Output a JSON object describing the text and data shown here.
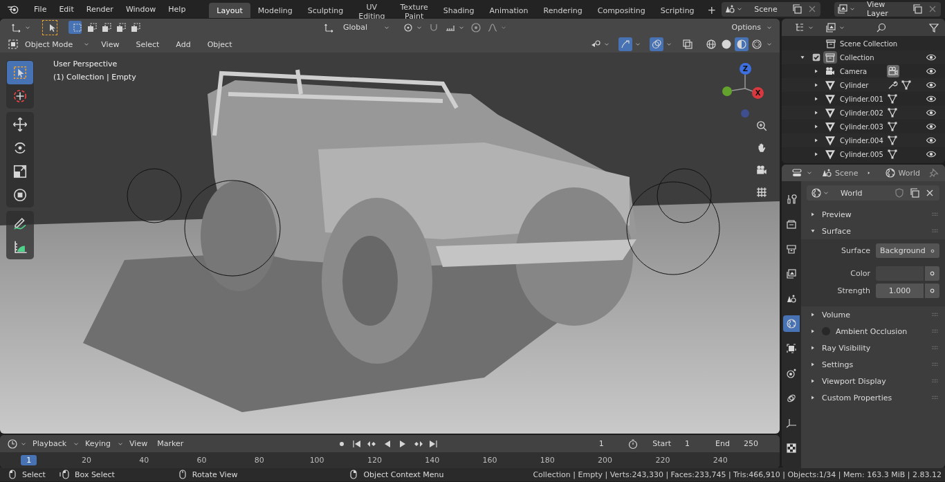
{
  "topbar": {
    "menus": [
      "File",
      "Edit",
      "Render",
      "Window",
      "Help"
    ],
    "workspaces": [
      {
        "label": "Layout",
        "selected": true
      },
      {
        "label": "Modeling",
        "selected": false
      },
      {
        "label": "Sculpting",
        "selected": false
      },
      {
        "label": "UV Editing",
        "selected": false
      },
      {
        "label": "Texture Paint",
        "selected": false
      },
      {
        "label": "Shading",
        "selected": false
      },
      {
        "label": "Animation",
        "selected": false
      },
      {
        "label": "Rendering",
        "selected": false
      },
      {
        "label": "Compositing",
        "selected": false
      },
      {
        "label": "Scripting",
        "selected": false
      }
    ],
    "add_workspace": "+",
    "scene": "Scene",
    "view_layer": "View Layer"
  },
  "viewport": {
    "tool_settings": {
      "select_modes": [
        {
          "kind": "new",
          "selected": true
        },
        {
          "kind": "extend",
          "selected": false
        },
        {
          "kind": "subtract",
          "selected": false
        },
        {
          "kind": "invert",
          "selected": false
        },
        {
          "kind": "intersect",
          "selected": false
        }
      ],
      "orientation": "Global",
      "options": "Options"
    },
    "header": {
      "mode": "Object Mode",
      "menus": [
        "View",
        "Select",
        "Add",
        "Object"
      ],
      "gizmos": true,
      "overlays": true,
      "shading": [
        {
          "kind": "wireframe",
          "selected": false
        },
        {
          "kind": "solid",
          "selected": false
        },
        {
          "kind": "material",
          "selected": true
        },
        {
          "kind": "rendered",
          "selected": false
        }
      ]
    },
    "info": [
      "User Perspective",
      "(1) Collection | Empty"
    ],
    "gizmo_labels": {
      "z": "Z",
      "x": "X"
    },
    "tool_groups": [
      [
        {
          "kind": "select",
          "selected": true
        },
        {
          "kind": "cursor",
          "selected": false
        }
      ],
      [
        {
          "kind": "move",
          "selected": false
        },
        {
          "kind": "rotate",
          "selected": false
        },
        {
          "kind": "scale",
          "selected": false
        },
        {
          "kind": "transform",
          "selected": false
        }
      ],
      [
        {
          "kind": "annotate",
          "selected": false
        },
        {
          "kind": "measure",
          "selected": false
        }
      ]
    ]
  },
  "timeline": {
    "menus": [
      "Playback",
      "Keying",
      "View",
      "Marker"
    ],
    "current_frame": "1",
    "start_label": "Start",
    "start": "1",
    "end_label": "End",
    "end": "250",
    "ruler": [
      {
        "label": "1",
        "selected": true
      },
      {
        "label": "20",
        "selected": false
      },
      {
        "label": "40",
        "selected": false
      },
      {
        "label": "60",
        "selected": false
      },
      {
        "label": "80",
        "selected": false
      },
      {
        "label": "100",
        "selected": false
      },
      {
        "label": "120",
        "selected": false
      },
      {
        "label": "140",
        "selected": false
      },
      {
        "label": "160",
        "selected": false
      },
      {
        "label": "180",
        "selected": false
      },
      {
        "label": "200",
        "selected": false
      },
      {
        "label": "220",
        "selected": false
      },
      {
        "label": "240",
        "selected": false
      }
    ]
  },
  "status_bar": {
    "hints": [
      {
        "kind": "left",
        "label": "Select"
      },
      {
        "kind": "left_drag",
        "label": "Box Select"
      },
      {
        "kind": "middle",
        "label": "Rotate View"
      },
      {
        "kind": "right",
        "label": "Object Context Menu"
      }
    ],
    "stats": "Collection | Empty | Verts:243,330 | Faces:233,745 | Tris:466,910 | Objects:1/34 | Mem: 163.3 MiB | 2.83.12"
  },
  "outliner": {
    "root": "Scene Collection",
    "items": [
      {
        "label": "Collection",
        "kind": "collection",
        "expanded": true,
        "checked": true,
        "active": true,
        "visible": true,
        "children": [
          {
            "label": "Camera",
            "kind": "camera",
            "expanded": false,
            "active": false,
            "visible": true,
            "data": [
              {
                "kind": "camera_data"
              }
            ]
          },
          {
            "label": "Cylinder",
            "kind": "mesh",
            "expanded": false,
            "active": false,
            "visible": true,
            "data": [
              {
                "kind": "modifier"
              },
              {
                "kind": "mesh_data"
              }
            ]
          },
          {
            "label": "Cylinder.001",
            "kind": "mesh",
            "expanded": false,
            "active": false,
            "visible": true,
            "data": [
              {
                "kind": "mesh_data"
              }
            ]
          },
          {
            "label": "Cylinder.002",
            "kind": "mesh",
            "expanded": false,
            "active": false,
            "visible": true,
            "data": [
              {
                "kind": "mesh_data"
              }
            ]
          },
          {
            "label": "Cylinder.003",
            "kind": "mesh",
            "expanded": false,
            "active": false,
            "visible": true,
            "data": [
              {
                "kind": "mesh_data"
              }
            ]
          },
          {
            "label": "Cylinder.004",
            "kind": "mesh",
            "expanded": false,
            "active": false,
            "visible": true,
            "data": [
              {
                "kind": "mesh_data"
              }
            ]
          },
          {
            "label": "Cylinder.005",
            "kind": "mesh",
            "expanded": false,
            "active": false,
            "visible": true,
            "data": [
              {
                "kind": "mesh_data"
              }
            ]
          }
        ]
      }
    ]
  },
  "properties": {
    "breadcrumb": [
      "Scene",
      "World"
    ],
    "tabs": [
      {
        "kind": "tool",
        "selected": false
      },
      {
        "kind": "render",
        "selected": false
      },
      {
        "kind": "output",
        "selected": false
      },
      {
        "kind": "view_layer",
        "selected": false
      },
      {
        "kind": "scene",
        "selected": false
      },
      {
        "kind": "world",
        "selected": true
      },
      {
        "kind": "object",
        "selected": false
      },
      {
        "kind": "particles",
        "selected": false
      },
      {
        "kind": "physics",
        "selected": false
      },
      {
        "kind": "data",
        "selected": false
      },
      {
        "kind": "texture",
        "selected": false
      }
    ],
    "datablock": "World",
    "panels": [
      {
        "label": "Preview",
        "expanded": false
      },
      {
        "label": "Surface",
        "expanded": true,
        "fields": [
          {
            "kind": "menu",
            "label": "Surface",
            "value": "Background"
          },
          {
            "kind": "color",
            "label": "Color"
          },
          {
            "kind": "number",
            "label": "Strength",
            "value": "1.000"
          }
        ]
      },
      {
        "label": "Volume",
        "expanded": false
      },
      {
        "label": "Ambient Occlusion",
        "expanded": false,
        "enabled": false
      },
      {
        "label": "Ray Visibility",
        "expanded": false
      },
      {
        "label": "Settings",
        "expanded": false
      },
      {
        "label": "Viewport Display",
        "expanded": false
      },
      {
        "label": "Custom Properties",
        "expanded": false
      }
    ]
  }
}
